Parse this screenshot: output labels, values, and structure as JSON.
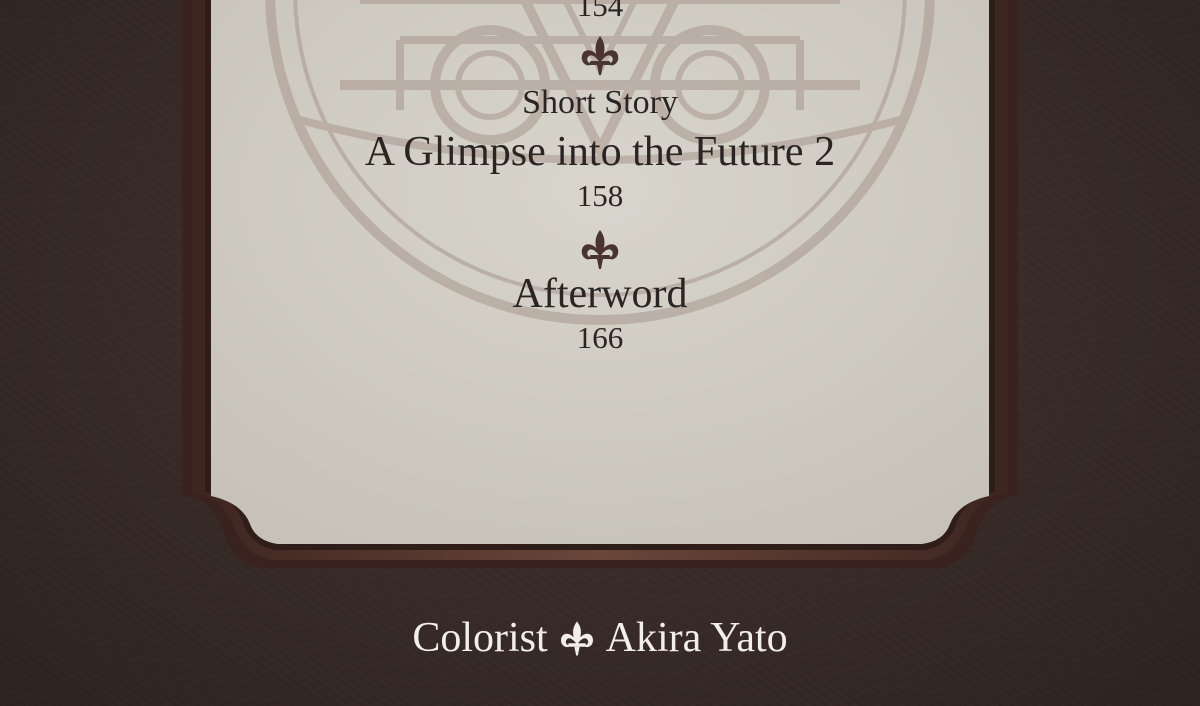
{
  "toc": {
    "entries": [
      {
        "label": "",
        "title": "",
        "page": "154"
      },
      {
        "label": "Short Story",
        "title": "A Glimpse into the Future 2",
        "page": "158"
      },
      {
        "label": "",
        "title": "Afterword",
        "page": "166"
      }
    ]
  },
  "credit": {
    "role": "Colorist",
    "name": "Akira Yato"
  },
  "colors": {
    "background": "#3b2d29",
    "frame": "#5a3a30",
    "panel": "#cfccc3",
    "text": "#2a2523",
    "ornament": "#4a3430",
    "credit_text": "#f2eee8"
  },
  "icons": {
    "divider": "fleur-de-lis-icon",
    "watermark": "magic-circle-emblem"
  }
}
